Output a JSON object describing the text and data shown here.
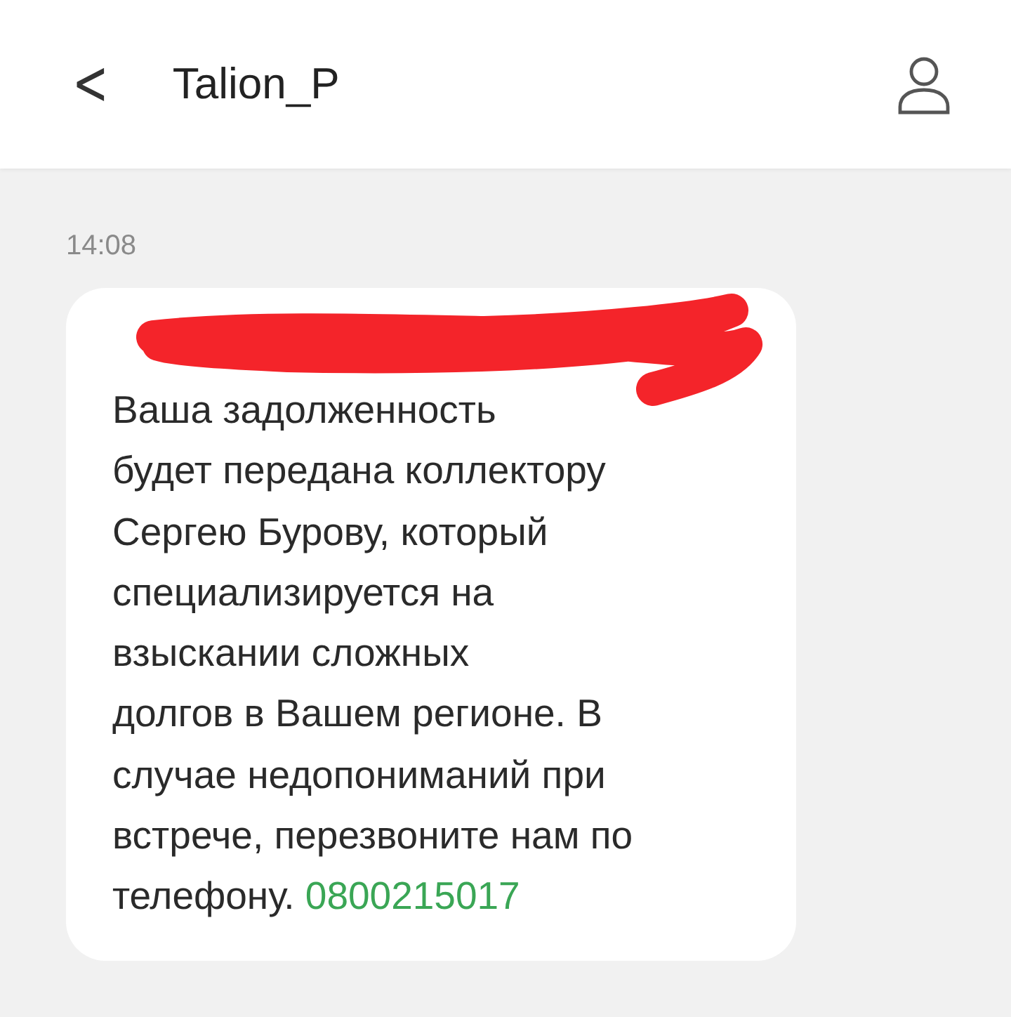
{
  "header": {
    "back": "<",
    "title": "Talion_P"
  },
  "messages": [
    {
      "time": "14:08",
      "text": "Ваша задолженность\nбудет передана коллектору\nСергею Бурову, который\nспециализируется на\nвзыскании сложных\nдолгов в Вашем регионе. В\nслучае недопониманий при\nвстрече, перезвоните нам по\nтелефону.",
      "phone": "0800215017",
      "redacted": true
    }
  ]
}
